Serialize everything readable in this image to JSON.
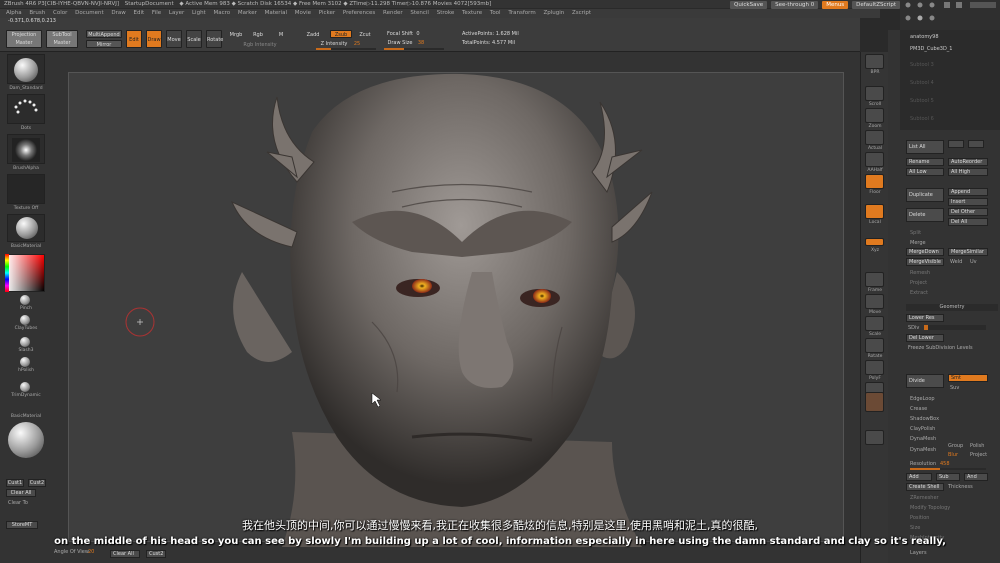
{
  "titlebar": {
    "app": "ZBrush 4R6 P3[CIB-IYHE-QBVN-NVJI-NRVJ]",
    "doc": "StartupDocument",
    "stats": "◆ Active Mem 983 ◆ Scratch Disk 16534 ◆ Free Mem 3102 ◆ ZTime▷11.298 Timer▷10.876 Movies 4072[593mb]"
  },
  "top_right": {
    "quicksave": "QuickSave",
    "seethrough": "See-through",
    "seethrough_value": "0",
    "menus": "Menus",
    "defaultzscript": "DefaultZScript"
  },
  "menus": [
    "Alpha",
    "Brush",
    "Color",
    "Document",
    "Draw",
    "Edit",
    "File",
    "Layer",
    "Light",
    "Macro",
    "Marker",
    "Material",
    "Movie",
    "Picker",
    "Preferences",
    "Render",
    "Stencil",
    "Stroke",
    "Texture",
    "Tool",
    "Transform",
    "Zplugin",
    "Zscript"
  ],
  "coords": "-0.371,0.678,0.213",
  "toolbar": {
    "projection_master": "Projection Master",
    "subtool_master": "SubTool Master",
    "multiappend": "MultiAppend",
    "mirror": "Mirror",
    "edit": "Edit",
    "draw": "Draw",
    "move": "Move",
    "scale": "Scale",
    "rotate": "Rotate",
    "mrgb": "Mrgb",
    "rgb": "Rgb",
    "m": "M",
    "zadd": "Zadd",
    "zsub": "Zsub",
    "zcut": "Zcut",
    "rgb_intensity": "Rgb Intensity",
    "z_intensity": "Z Intensity",
    "z_intensity_value": "25",
    "focal_shift": "Focal Shift",
    "focal_shift_value": "0",
    "draw_size": "Draw Size",
    "draw_size_value": "38",
    "active_points": "ActivePoints: 1.628 Mil",
    "total_points": "TotalPoints: 4.577 Mil"
  },
  "left_shelf": {
    "brush": "Dam_Standard",
    "stroke": "Dots",
    "alpha": "BrushAlpha",
    "texture": "Texture Off",
    "material": "BasicMaterial",
    "brushes": [
      "Pinch",
      "ClayTubes",
      "Slash3",
      "hPolish",
      "TrimDynamic",
      "BasicMaterial"
    ],
    "cust1": "Cust1",
    "cust2": "Cust2",
    "clear_all": "Clear All",
    "clear_to": "Clear To",
    "store_mt": "StoreMT"
  },
  "right_shelf": {
    "buttons": [
      "BPR",
      "SPix",
      "Scroll",
      "Zoom",
      "Actual",
      "AAHalf",
      "Persp",
      "Floor",
      "Local",
      "Lsym",
      "Xyz",
      "Frame",
      "Move",
      "Scale",
      "Rotate",
      "Line Fill",
      "PolyF",
      "Transp",
      "Ghost",
      "Solo",
      "Xpose"
    ]
  },
  "right_panel": {
    "subtools": [
      "anatomy98",
      "PM3D_Cube3D_1",
      "Subtool 3",
      "Subtool 4",
      "Subtool 5",
      "Subtool 6",
      "Subtool 7"
    ],
    "list_all": "List All",
    "rename": "Rename",
    "autoreorder": "AutoReorder",
    "all_low": "All Low",
    "all_high": "All High",
    "duplicate": "Duplicate",
    "append": "Append",
    "insert": "Insert",
    "delete": "Delete",
    "del_other": "Del Other",
    "del_all": "Del All",
    "split": "Split",
    "merge": "Merge",
    "mergedown": "MergeDown",
    "mergesimilar": "MergeSimilar",
    "mergevisible": "MergeVisible",
    "weld": "Weld",
    "uv": "Uv",
    "remesh": "Remesh",
    "project": "Project",
    "extract": "Extract",
    "geometry": "Geometry",
    "lower_res": "Lower Res",
    "sdiv": "SDiv",
    "del_lower": "Del Lower",
    "freeze": "Freeze SubDivision Levels",
    "divide": "Divide",
    "smt": "Smt",
    "suv": "Suv",
    "edgeloop": "EdgeLoop",
    "crease": "Crease",
    "shadowbox": "ShadowBox",
    "claypolish": "ClayPolish",
    "dynamesh": "DynaMesh",
    "dynamesh_btn": "DynaMesh",
    "group": "Group",
    "polish": "Polish",
    "blur": "Blur",
    "project2": "Project",
    "resolution": "Resolution",
    "resolution_value": "458",
    "add": "Add",
    "sub": "Sub",
    "and": "And",
    "create_shell": "Create Shell",
    "thickness": "Thickness",
    "zremesher": "ZRemesher",
    "modify_topology": "Modify Topology",
    "position": "Position",
    "size": "Size",
    "meshintegrity": "MeshIntegrity",
    "layers": "Layers"
  },
  "bottombar": {
    "angle_of_view": "Angle Of View",
    "angle_value": "20",
    "clear_all": "Clear All",
    "cust2": "Cust2"
  },
  "subtitles": {
    "cn": "我在他头顶的中间,你可以通过慢慢来看,我正在收集很多酷炫的信息,特别是这里,使用黑哨和泥土,真的很酷,",
    "en": "on the middle of his head so you can see by slowly I'm building up a lot of cool, information especially in here using the damn standard and clay so it's really,"
  },
  "colors": {
    "accent": "#e07a1f",
    "panel": "#333333",
    "canvas": "#3e3e3e"
  }
}
